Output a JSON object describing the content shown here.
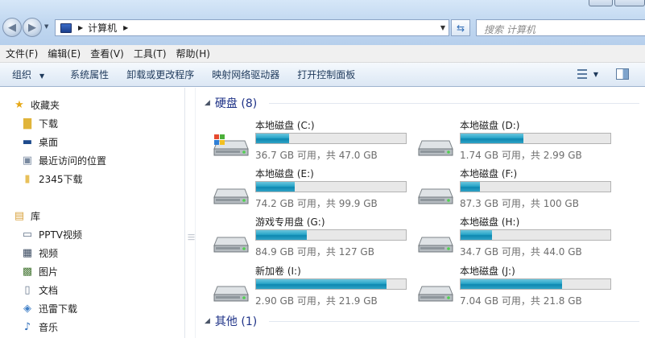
{
  "address_bar": {
    "path": "计算机",
    "search_placeholder": "搜索 计算机"
  },
  "menu": [
    "文件(F)",
    "编辑(E)",
    "查看(V)",
    "工具(T)",
    "帮助(H)"
  ],
  "toolbar": {
    "organize": "组织",
    "system_properties": "系统属性",
    "uninstall": "卸载或更改程序",
    "map_drive": "映射网络驱动器",
    "control_panel": "打开控制面板"
  },
  "sidebar": {
    "favorites": "收藏夹",
    "fav_items": [
      "下载",
      "桌面",
      "最近访问的位置",
      "2345下载"
    ],
    "libraries": "库",
    "lib_items": [
      "PPTV视频",
      "视频",
      "图片",
      "文档",
      "迅雷下载",
      "音乐"
    ]
  },
  "groups": {
    "hard_disks": "硬盘 (8)",
    "other": "其他 (1)"
  },
  "drives": [
    {
      "name": "本地磁盘 (C:)",
      "info": "36.7 GB 可用，共 47.0 GB",
      "used_fraction": 0.22,
      "system": true
    },
    {
      "name": "本地磁盘 (D:)",
      "info": "1.74 GB 可用，共 2.99 GB",
      "used_fraction": 0.42,
      "system": false
    },
    {
      "name": "本地磁盘 (E:)",
      "info": "74.2 GB 可用，共 99.9 GB",
      "used_fraction": 0.26,
      "system": false
    },
    {
      "name": "本地磁盘 (F:)",
      "info": "87.3 GB 可用，共 100 GB",
      "used_fraction": 0.13,
      "system": false
    },
    {
      "name": "游戏专用盘 (G:)",
      "info": "84.9 GB 可用，共 127 GB",
      "used_fraction": 0.34,
      "system": false
    },
    {
      "name": "本地磁盘 (H:)",
      "info": "34.7 GB 可用，共 44.0 GB",
      "used_fraction": 0.21,
      "system": false
    },
    {
      "name": "新加卷 (I:)",
      "info": "2.90 GB 可用，共 21.9 GB",
      "used_fraction": 0.87,
      "system": false
    },
    {
      "name": "本地磁盘 (J:)",
      "info": "7.04 GB 可用，共 21.8 GB",
      "used_fraction": 0.68,
      "system": false
    }
  ]
}
